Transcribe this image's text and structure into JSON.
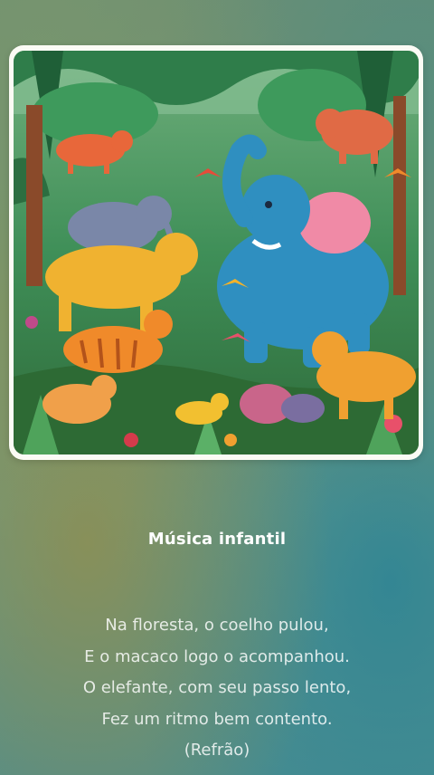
{
  "cover": {
    "description_icon": "jungle-animals-illustration"
  },
  "song": {
    "title": "Música infantil",
    "lyrics": [
      "Na floresta, o coelho pulou,",
      "E o macaco logo o acompanhou.",
      "O elefante, com seu passo lento,",
      "Fez um ritmo bem contento.",
      "(Refrão)"
    ]
  },
  "colors": {
    "title_text": "#ffffff",
    "lyrics_text": "#ffffffd1",
    "card_border": "#fbfbf5"
  }
}
